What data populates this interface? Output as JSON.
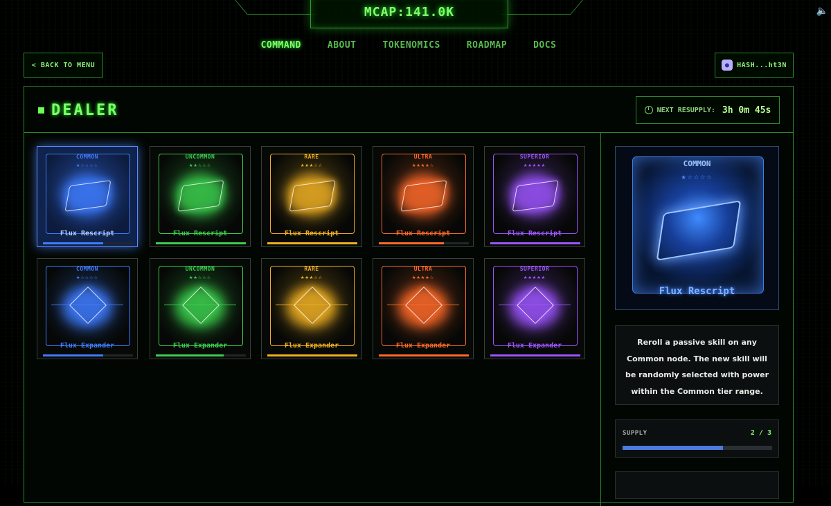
{
  "header": {
    "mcap_label": "MCAP:141.0K",
    "nav": [
      "COMMAND",
      "ABOUT",
      "TOKENOMICS",
      "ROADMAP",
      "DOCS"
    ],
    "active_nav": "COMMAND",
    "back_label": "< BACK TO MENU",
    "wallet_label": "HASH...ht3N"
  },
  "panel": {
    "title": "DEALER",
    "resupply_label": "NEXT RESUPPLY:",
    "resupply_timer": "3h 0m 45s"
  },
  "colors": {
    "common": "#3f7cff",
    "uncommon": "#3ccf4e",
    "rare": "#f0b024",
    "ultra": "#ff6a2a",
    "superior": "#9d55ff",
    "accent": "#7dff6a"
  },
  "cards": [
    {
      "rarity": "COMMON",
      "stars": 1,
      "name": "Flux Rescript",
      "icon": "rescript-device-icon",
      "stock": 0.67,
      "color": "#3f7cff",
      "selected": true
    },
    {
      "rarity": "UNCOMMON",
      "stars": 2,
      "name": "Flux Rescript",
      "icon": "rescript-device-icon",
      "stock": 1.0,
      "color": "#3ccf4e"
    },
    {
      "rarity": "RARE",
      "stars": 3,
      "name": "Flux Rescript",
      "icon": "rescript-device-icon",
      "stock": 1.0,
      "color": "#f0b024"
    },
    {
      "rarity": "ULTRA",
      "stars": 4,
      "name": "Flux Rescript",
      "icon": "rescript-device-icon",
      "stock": 0.72,
      "color": "#ff6a2a"
    },
    {
      "rarity": "SUPERIOR",
      "stars": 5,
      "name": "Flux Rescript",
      "icon": "rescript-device-icon",
      "stock": 1.0,
      "color": "#9d55ff"
    },
    {
      "rarity": "COMMON",
      "stars": 1,
      "name": "Flux Expander",
      "icon": "expander-cube-icon",
      "stock": 0.67,
      "color": "#3f7cff"
    },
    {
      "rarity": "UNCOMMON",
      "stars": 2,
      "name": "Flux Expander",
      "icon": "expander-cube-icon",
      "stock": 0.75,
      "color": "#3ccf4e"
    },
    {
      "rarity": "RARE",
      "stars": 3,
      "name": "Flux Expander",
      "icon": "expander-cube-icon",
      "stock": 1.0,
      "color": "#f0b024"
    },
    {
      "rarity": "ULTRA",
      "stars": 4,
      "name": "Flux Expander",
      "icon": "expander-cube-icon",
      "stock": 1.0,
      "color": "#ff6a2a"
    },
    {
      "rarity": "SUPERIOR",
      "stars": 5,
      "name": "Flux Expander",
      "icon": "expander-cube-icon",
      "stock": 1.0,
      "color": "#9d55ff"
    }
  ],
  "detail": {
    "rarity": "COMMON",
    "stars": 1,
    "name": "Flux Rescript",
    "description": "Reroll a passive skill on any Common node. The new skill will be randomly selected with power within the Common tier range.",
    "supply_label": "SUPPLY",
    "supply_value": "2 / 3",
    "supply_fraction": 0.67
  }
}
